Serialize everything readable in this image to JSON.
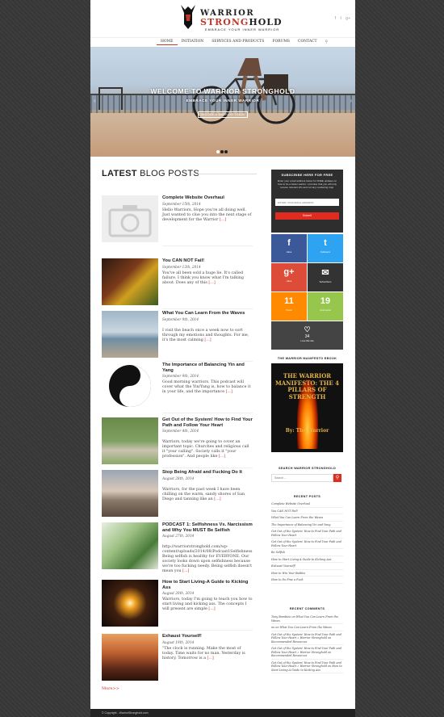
{
  "header": {
    "brand_line1": "WARRIOR",
    "brand_line2a": "STRONG",
    "brand_line2b": "HOLD",
    "tagline": "EMBRACE YOUR INNER WARRIOR",
    "social": [
      "f",
      "t",
      "g+"
    ]
  },
  "nav": {
    "items": [
      "HOME",
      "INITIATION",
      "SERVICES AND PRODUCTS",
      "FORUMS",
      "CONTACT"
    ],
    "active": "HOME"
  },
  "hero": {
    "headline": "WELCOME TO WARRIOR STRONGHOLD",
    "sub": "EMBRACE YOUR INNER WARRIOR",
    "cta": "BECOME A WARRIOR TODAY",
    "prev": "‹",
    "next": "›"
  },
  "main": {
    "section_title_bold": "LATEST",
    "section_title_thin": " BLOG POSTS",
    "more": "More>>",
    "posts": [
      {
        "title": "Complete Website Overhaul",
        "date": "September 15th, 2014",
        "excerpt": "Hello Warriors, Hope you're all doing well. Just wanted to clue you into the next stage of development for the Warrior",
        "more": "[...]"
      },
      {
        "title": "You CAN NOT Fail!",
        "date": "September 12th, 2014",
        "excerpt": "You've all been sold a huge lie. It's called failure. I think you know what I'm talking about. Does any of this",
        "more": "[...]"
      },
      {
        "title": "What You Can Learn From the Waves",
        "date": "September 9th, 2014",
        "excerpt": "I visit the beach once a week now to sort through my emotions and thoughts. For me, it's the most calming",
        "more": "[...]"
      },
      {
        "title": "The Importance of Balancing Yin and Yang",
        "date": "September 9th, 2014",
        "excerpt": "Good morning warriors. This podcast will cover what the Yin/Yang is, how to balance it in your life, and the importance",
        "more": "[...]"
      },
      {
        "title": "Get Out of the System! How to Find Your Path and Follow Your Heart",
        "date": "September 4th, 2014",
        "excerpt": "Warriors, today we're going to cover an important topic. Churches and religious call it \"your calling\". Society calls it \"your profession\". And people like",
        "more": "[...]"
      },
      {
        "title": "Stop Being Afraid and Fucking Do It",
        "date": "August 28th, 2014",
        "excerpt": "Warriors, for the past week I have been chilling on the warm, sandy shores of San Diego and tanning like an",
        "more": "[...]"
      },
      {
        "title": "PODCAST 1: Selfishness Vs. Narcissism and Why You MUST Be Selfish",
        "date": "August 27th, 2014",
        "excerpt": "http://warriorstronghold.com/wp-content/uploads/2014/08/Podcast1Selfishness Being selfish is healthy for EVERYONE. Our society looks down upon selfishness because we're too fucking needy. Being selfish doesn't mean you",
        "more": "[...]"
      },
      {
        "title": "How to Start Living-A Guide to Kicking Ass",
        "date": "August 20th, 2014",
        "excerpt": "Warriors, today I'm going to teach you how to start living and kicking ass. The concepts I will present are simple",
        "more": "[...]"
      },
      {
        "title": "Exhaust Yourself!",
        "date": "August 19th, 2014",
        "excerpt": "\"The clock is running. Make the most of today. Time waits for no man. Yesterday is history. Tomorrow is a",
        "more": "[...]"
      }
    ]
  },
  "sidebar": {
    "subscribe_title": "SUBSCRIBE HERE FOR FREE",
    "subscribe_desc": "Enter your email address below for FREE updates on how to be a better warrior. I promise that you will only receive relevant info and not any marketing crap.",
    "email_placeholder": "ENTER YOUR EMAIL ADDRESS",
    "submit_label": "Submit",
    "share_tiles": [
      {
        "icon": "f",
        "label": "Likes",
        "color": "#3b5998"
      },
      {
        "icon": "t",
        "label": "Followers",
        "color": "#2ea3f2"
      },
      {
        "icon": "g+",
        "label": "Likes",
        "color": "#dd4b39"
      },
      {
        "icon": "✉",
        "label": "Subscribers",
        "color": "#333333"
      },
      {
        "icon": "11",
        "label": "Posts",
        "color": "#ff8a00"
      },
      {
        "icon": "19",
        "label": "Comments",
        "color": "#96c64b"
      }
    ],
    "love_count": "34",
    "love_label": "Love this site",
    "ebook_title": "THE WARRIOR MANIFESTO EBOOK",
    "ebook_text": "THE WARRIOR MANIFESTO: THE 4 PILLARS OF STRENGTH",
    "ebook_by": "By: The Warrior",
    "search_title": "SEARCH WARRIOR STRONGHOLD",
    "search_placeholder": "Search …",
    "recent_posts_title": "RECENT POSTS",
    "recent_posts": [
      "Complete Website Overhaul",
      "You CAN NOT Fail!",
      "What You Can Learn From the Waves",
      "The Importance of Balancing Yin and Yang",
      "Get Out of the System! How to Find Your Path and Follow Your Heart",
      "Get Out of the System! How to Find Your Path and Follow Your Heart",
      "Be Selfish",
      "How to Start Living-A Guide to Kicking Ass",
      "Exhaust Yourself!",
      "How to Win Your Battles",
      "How to Do Fine a Fuck"
    ],
    "recent_comments_title": "RECENT COMMENTS",
    "recent_comments": [
      "Tony Bambino on What You Can Learn From the Waves",
      "no on What You Can Learn From the Waves",
      "Get Out of the System! How to Find Your Path and Follow Your Heart » Warrior Stronghold on Recommended Resources",
      "Get Out of the System! How to Find Your Path and Follow Your Heart » Warrior Stronghold on Recommended Resources",
      "Get Out of the System! How to Find Your Path and Follow Your Heart » Warrior Stronghold on How to Start Living-A Guide to Kicking Ass"
    ]
  },
  "footer": {
    "copyright": "© Copyright - WarriorStronghold.com"
  }
}
